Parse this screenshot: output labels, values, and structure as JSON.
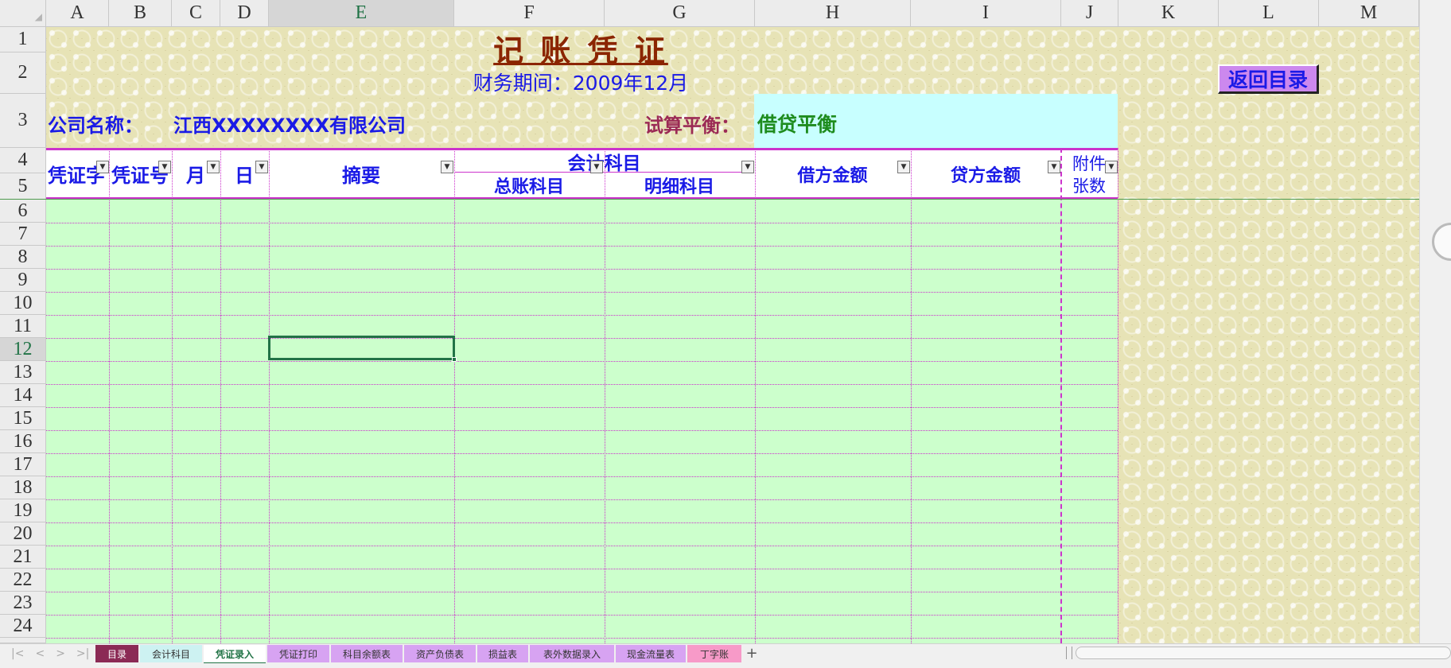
{
  "columns": [
    {
      "id": "corner-top",
      "label": "◢"
    },
    {
      "id": "A",
      "label": "A"
    },
    {
      "id": "B",
      "label": "B"
    },
    {
      "id": "C",
      "label": "C"
    },
    {
      "id": "D",
      "label": "D"
    },
    {
      "id": "E",
      "label": "E"
    },
    {
      "id": "F",
      "label": "F"
    },
    {
      "id": "G",
      "label": "G"
    },
    {
      "id": "H",
      "label": "H"
    },
    {
      "id": "I",
      "label": "I"
    },
    {
      "id": "J",
      "label": "J"
    },
    {
      "id": "K",
      "label": "K"
    },
    {
      "id": "L",
      "label": "L"
    },
    {
      "id": "M",
      "label": "M"
    }
  ],
  "rows": [
    "1",
    "2",
    "3",
    "4",
    "5",
    "6",
    "7",
    "8",
    "9",
    "10",
    "11",
    "12",
    "13",
    "14",
    "15",
    "16",
    "17",
    "18",
    "19",
    "20",
    "21",
    "22",
    "23",
    "24"
  ],
  "selected_cell": {
    "column": "E",
    "row": "12"
  },
  "header": {
    "title": "记 账 凭 证",
    "period": "财务期间：2009年12月",
    "back_button": "返回目录",
    "company_label": "公司名称：",
    "company_name": "江西XXXXXXXX有限公司",
    "balance_label": "试算平衡：",
    "balance_status": "借贷平衡"
  },
  "table_headers": {
    "voucher_type": "凭证字",
    "voucher_no": "凭证号",
    "month": "月",
    "day": "日",
    "summary": "摘要",
    "account": "会计科目",
    "general_account": "总账科目",
    "detail_account": "明细科目",
    "debit": "借方金额",
    "credit": "贷方金额",
    "attachments_line1": "附件",
    "attachments_line2": "张数"
  },
  "sheet_tabs": [
    {
      "label": "目录",
      "bg": "#8b2a55",
      "fg": "#ffffff"
    },
    {
      "label": "会计科目",
      "bg": "#cdf2f2",
      "fg": "#333333"
    },
    {
      "label": "凭证录入",
      "bg": "#ffffff",
      "fg": "#217346",
      "active": true
    },
    {
      "label": "凭证打印",
      "bg": "#d7a3f2",
      "fg": "#333333"
    },
    {
      "label": "科目余额表",
      "bg": "#d7a3f2",
      "fg": "#333333"
    },
    {
      "label": "资产负债表",
      "bg": "#d7a3f2",
      "fg": "#333333"
    },
    {
      "label": "损益表",
      "bg": "#d7a3f2",
      "fg": "#333333"
    },
    {
      "label": "表外数据录入",
      "bg": "#d7a3f2",
      "fg": "#333333"
    },
    {
      "label": "现金流量表",
      "bg": "#d7a3f2",
      "fg": "#333333"
    },
    {
      "label": "丁字账",
      "bg": "#f79ac8",
      "fg": "#333333"
    }
  ],
  "add_sheet": "+",
  "colors": {
    "title": "#8b2500",
    "blue_text": "#1a1ae6",
    "balance_label": "#9b2a55",
    "balance_status": "#1e8c1e",
    "balance_bg": "#c8ffff",
    "data_bg": "#ccffcc",
    "grid": "#cc33cc",
    "back_button_bg": "#cc88ee"
  }
}
